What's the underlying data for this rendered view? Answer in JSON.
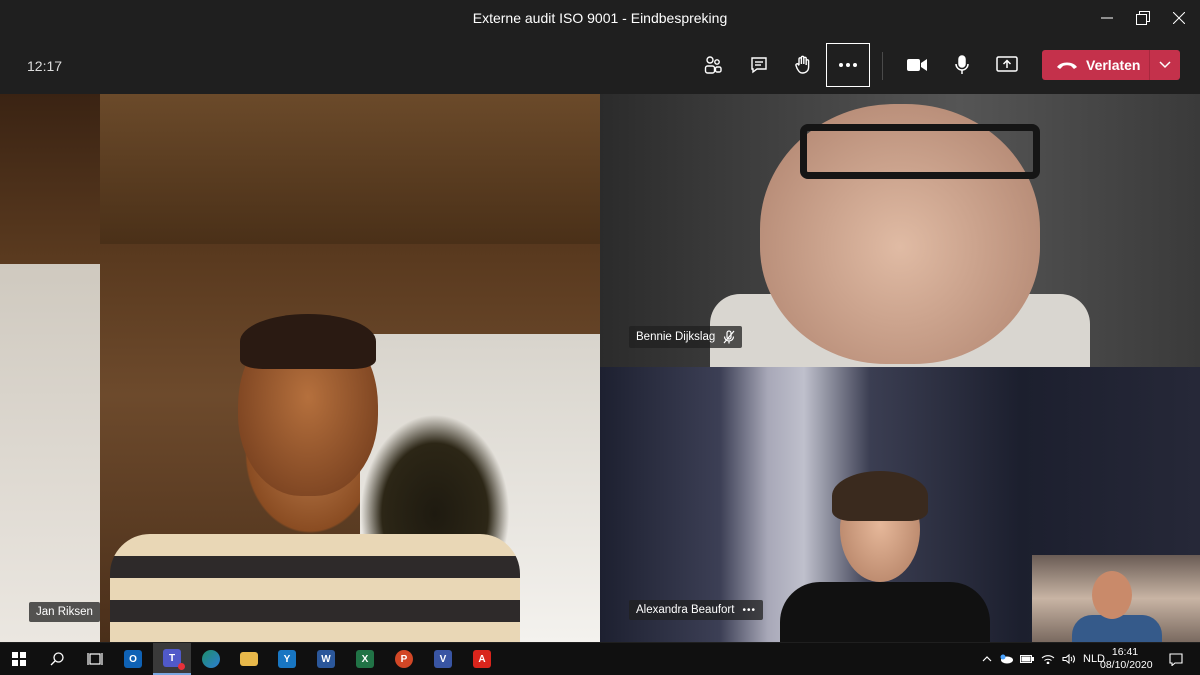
{
  "window": {
    "title": "Externe audit ISO 9001 - Eindbespreking",
    "controls": [
      "minimize-icon",
      "restore-icon",
      "close-icon"
    ]
  },
  "toolbar": {
    "call_duration": "12:17",
    "buttons": [
      "participants-icon",
      "chat-icon",
      "raise-hand-icon",
      "more-options-icon",
      "camera-icon",
      "microphone-icon",
      "share-screen-icon"
    ],
    "leave_label": "Verlaten",
    "leave_color": "#c4314b"
  },
  "participants": [
    {
      "name": "Jan Riksen",
      "muted": false
    },
    {
      "name": "Bennie Dijkslag",
      "muted": true
    },
    {
      "name": "Alexandra Beaufort",
      "has_more_menu": true,
      "more_glyph": "•••"
    }
  ],
  "taskbar": {
    "apps": [
      "windows-start-icon",
      "search-icon",
      "task-view-icon",
      "outlook-icon",
      "teams-icon",
      "edge-beta-icon",
      "file-explorer-icon",
      "yammer-icon",
      "word-icon",
      "excel-icon",
      "powerpoint-icon",
      "visio-icon",
      "acrobat-icon"
    ],
    "app_letters": {
      "outlook": "O",
      "yammer": "Y",
      "word": "W",
      "excel": "X",
      "powerpoint": "P",
      "visio": "V",
      "acrobat": "A"
    },
    "language": "NLD",
    "time": "16:41",
    "date": "08/10/2020"
  }
}
